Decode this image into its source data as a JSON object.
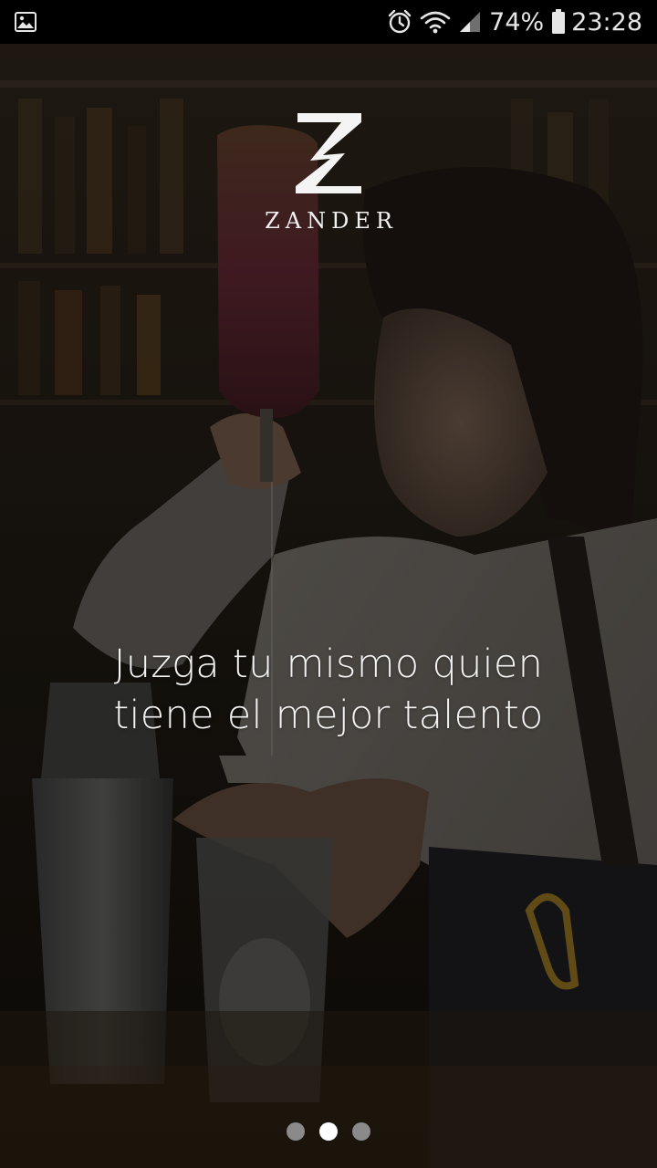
{
  "status_bar": {
    "battery_percent": "74%",
    "time": "23:28",
    "icons": [
      "image-icon",
      "alarm-icon",
      "wifi-icon",
      "signal-icon",
      "battery-icon"
    ]
  },
  "brand": {
    "name": "ZANDER",
    "logo_icon": "zander-logo-icon"
  },
  "onboarding": {
    "headline": [
      "Juzga tu mismo quien",
      "tiene el mejor talento"
    ],
    "pages_total": 3,
    "active_page": 2
  },
  "colors": {
    "status_bar_bg": "#000000",
    "text": "#f4f4f4",
    "dot_active": "#ffffff",
    "dot_inactive": "#8a8a8a"
  }
}
